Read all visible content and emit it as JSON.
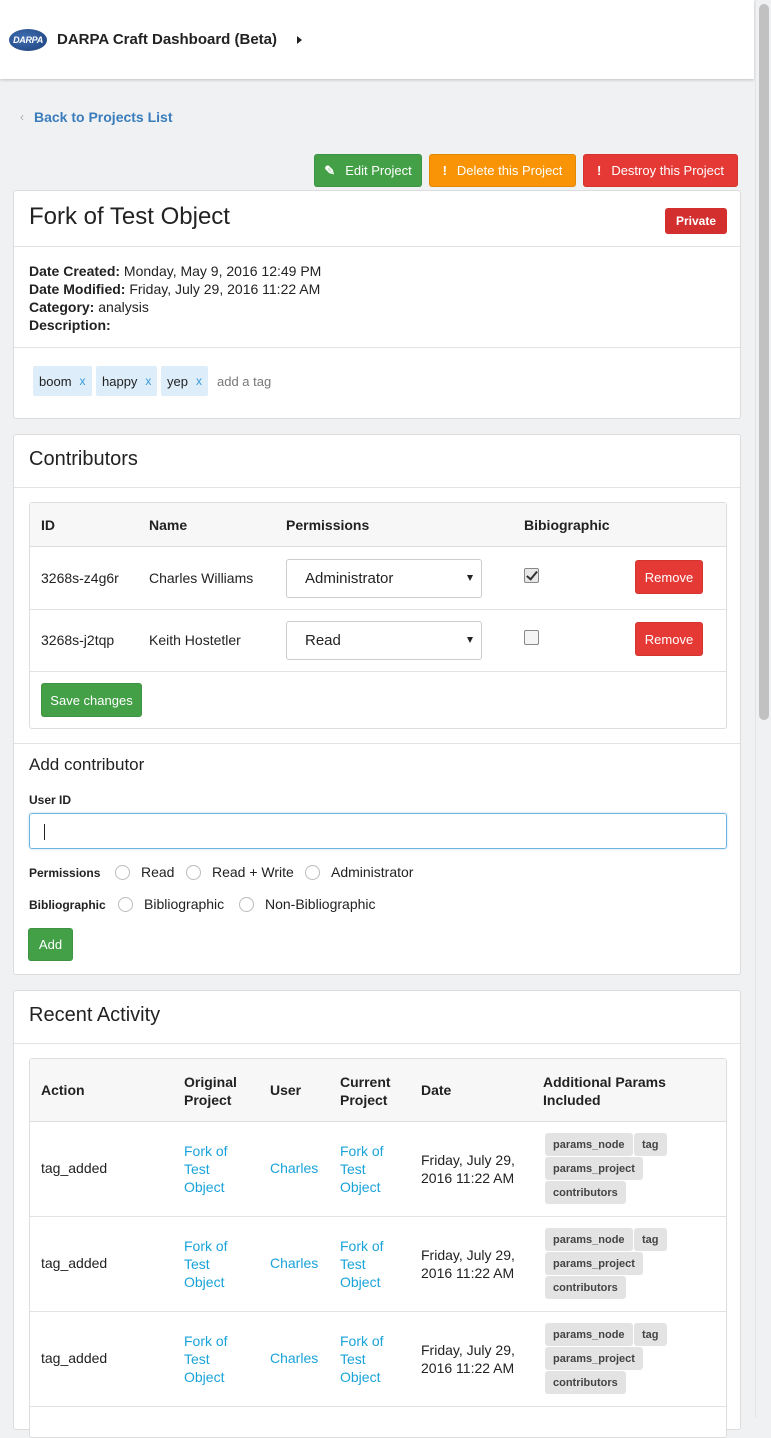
{
  "app": {
    "title": "DARPA Craft Dashboard (Beta)",
    "logo_text": "DARPA"
  },
  "nav": {
    "back_label": "Back to Projects List",
    "back_icon": "chevron-left-icon"
  },
  "actions": {
    "edit_label": "Edit Project",
    "edit_icon": "✎",
    "delete_label": "Delete this Project",
    "delete_icon": "!",
    "destroy_label": "Destroy this Project",
    "destroy_icon": "!"
  },
  "project": {
    "title": "Fork of Test Object",
    "visibility": "Private",
    "created_label": "Date Created:",
    "created": "Monday, May 9, 2016 12:49 PM",
    "modified_label": "Date Modified:",
    "modified": "Friday, July 29, 2016 11:22 AM",
    "category_label": "Category:",
    "category": "analysis",
    "description_label": "Description:",
    "description": "",
    "tags": [
      "boom",
      "happy",
      "yep"
    ],
    "tag_remove": "x",
    "add_tag_placeholder": "add a tag"
  },
  "contributors": {
    "title": "Contributors",
    "headers": [
      "ID",
      "Name",
      "Permissions",
      "Bibiographic"
    ],
    "rows": [
      {
        "id": "3268s-z4g6r",
        "name": "Charles Williams",
        "permission": "Administrator",
        "bibliographic": true,
        "remove_label": "Remove"
      },
      {
        "id": "3268s-j2tqp",
        "name": "Keith Hostetler",
        "permission": "Read",
        "bibliographic": false,
        "remove_label": "Remove"
      }
    ],
    "save_label": "Save changes"
  },
  "add_contributor": {
    "title": "Add contributor",
    "user_id_label": "User ID",
    "user_id_value": "",
    "permissions_label": "Permissions",
    "permission_options": [
      "Read",
      "Read + Write",
      "Administrator"
    ],
    "bibliographic_label": "Bibliographic",
    "bibliographic_options": [
      "Bibliographic",
      "Non-Bibliographic"
    ],
    "add_label": "Add"
  },
  "activity": {
    "title": "Recent Activity",
    "headers": {
      "action": "Action",
      "original_1": "Original",
      "original_2": "Project",
      "user": "User",
      "current_1": "Current",
      "current_2": "Project",
      "date": "Date",
      "params_1": "Additional Params",
      "params_2": "Included"
    },
    "rows": [
      {
        "action": "tag_added",
        "original": [
          "Fork of",
          "Test",
          "Object"
        ],
        "user": "Charles",
        "current": [
          "Fork of",
          "Test",
          "Object"
        ],
        "date": [
          "Friday, July 29,",
          "2016 11:22 AM"
        ],
        "params": [
          "params_node",
          "tag",
          "params_project",
          "contributors"
        ]
      },
      {
        "action": "tag_added",
        "original": [
          "Fork of",
          "Test",
          "Object"
        ],
        "user": "Charles",
        "current": [
          "Fork of",
          "Test",
          "Object"
        ],
        "date": [
          "Friday, July 29,",
          "2016 11:22 AM"
        ],
        "params": [
          "params_node",
          "tag",
          "params_project",
          "contributors"
        ]
      },
      {
        "action": "tag_added",
        "original": [
          "Fork of",
          "Test",
          "Object"
        ],
        "user": "Charles",
        "current": [
          "Fork of",
          "Test",
          "Object"
        ],
        "date": [
          "Friday, July 29,",
          "2016 11:22 AM"
        ],
        "params": [
          "params_node",
          "tag",
          "params_project",
          "contributors"
        ]
      }
    ]
  },
  "colors": {
    "green": "#43a047",
    "orange": "#f89406",
    "red": "#e53935",
    "link": "#1aa3d9",
    "back_link": "#3a7dbd"
  }
}
